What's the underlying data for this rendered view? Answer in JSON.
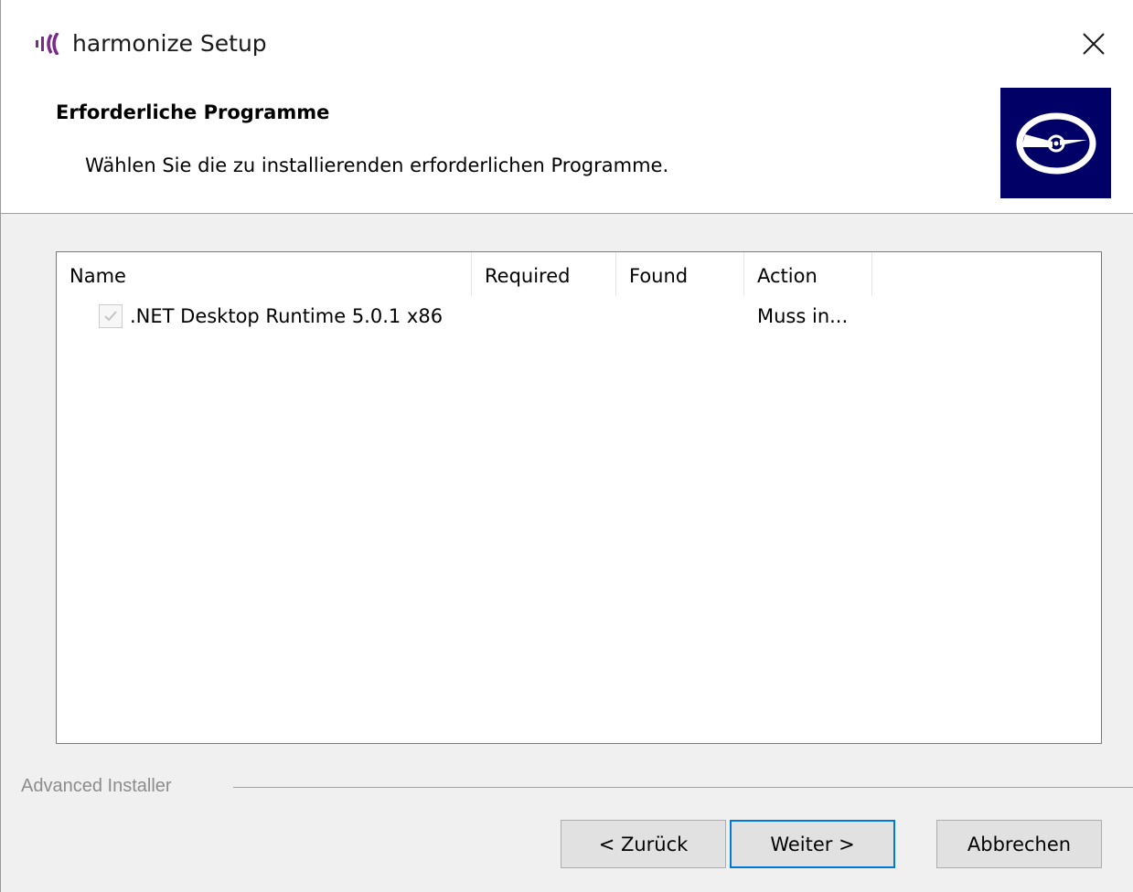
{
  "window": {
    "title": "harmonize Setup",
    "logo_color": "#7a2a8a",
    "close_label": "×"
  },
  "header": {
    "title": "Erforderliche Programme",
    "subtitle": "Wählen Sie die zu installierenden erforderlichen Programme.",
    "image_bg": "#000066",
    "image_icon": "cd-disc-icon"
  },
  "list": {
    "columns": [
      "Name",
      "Required",
      "Found",
      "Action"
    ],
    "rows": [
      {
        "checked": true,
        "name": ".NET Desktop Runtime 5.0.1 x86",
        "required": "",
        "found": "",
        "action": "Muss in..."
      }
    ]
  },
  "footer": {
    "brand": "Advanced Installer",
    "back_label": "< Zurück",
    "next_label": "Weiter >",
    "cancel_label": "Abbrechen",
    "default_button_color": "#0078d7"
  }
}
